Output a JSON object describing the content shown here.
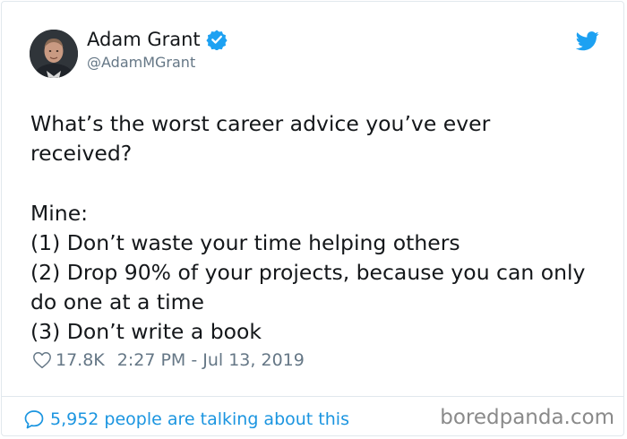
{
  "author": {
    "name": "Adam Grant",
    "handle": "@AdamMGrant",
    "verified": true
  },
  "tweet": {
    "lines": [
      "What’s the worst career advice you’ve ever",
      "received?",
      "",
      "Mine:",
      "(1) Don’t waste your time helping others",
      "(2) Drop 90% of your projects, because you can only",
      "do one at a time",
      "(3) Don’t write a book"
    ],
    "likes": "17.8K",
    "timestamp": "2:27 PM - Jul 13, 2019"
  },
  "footer": {
    "talking": "5,952 people are talking about this",
    "watermark": "boredpanda.com"
  },
  "colors": {
    "twitter_blue": "#1da1f2",
    "link_blue": "#1b95e0",
    "muted": "#657786"
  },
  "icons": [
    "verified-badge-icon",
    "twitter-bird-icon",
    "heart-icon",
    "speech-bubble-icon"
  ]
}
